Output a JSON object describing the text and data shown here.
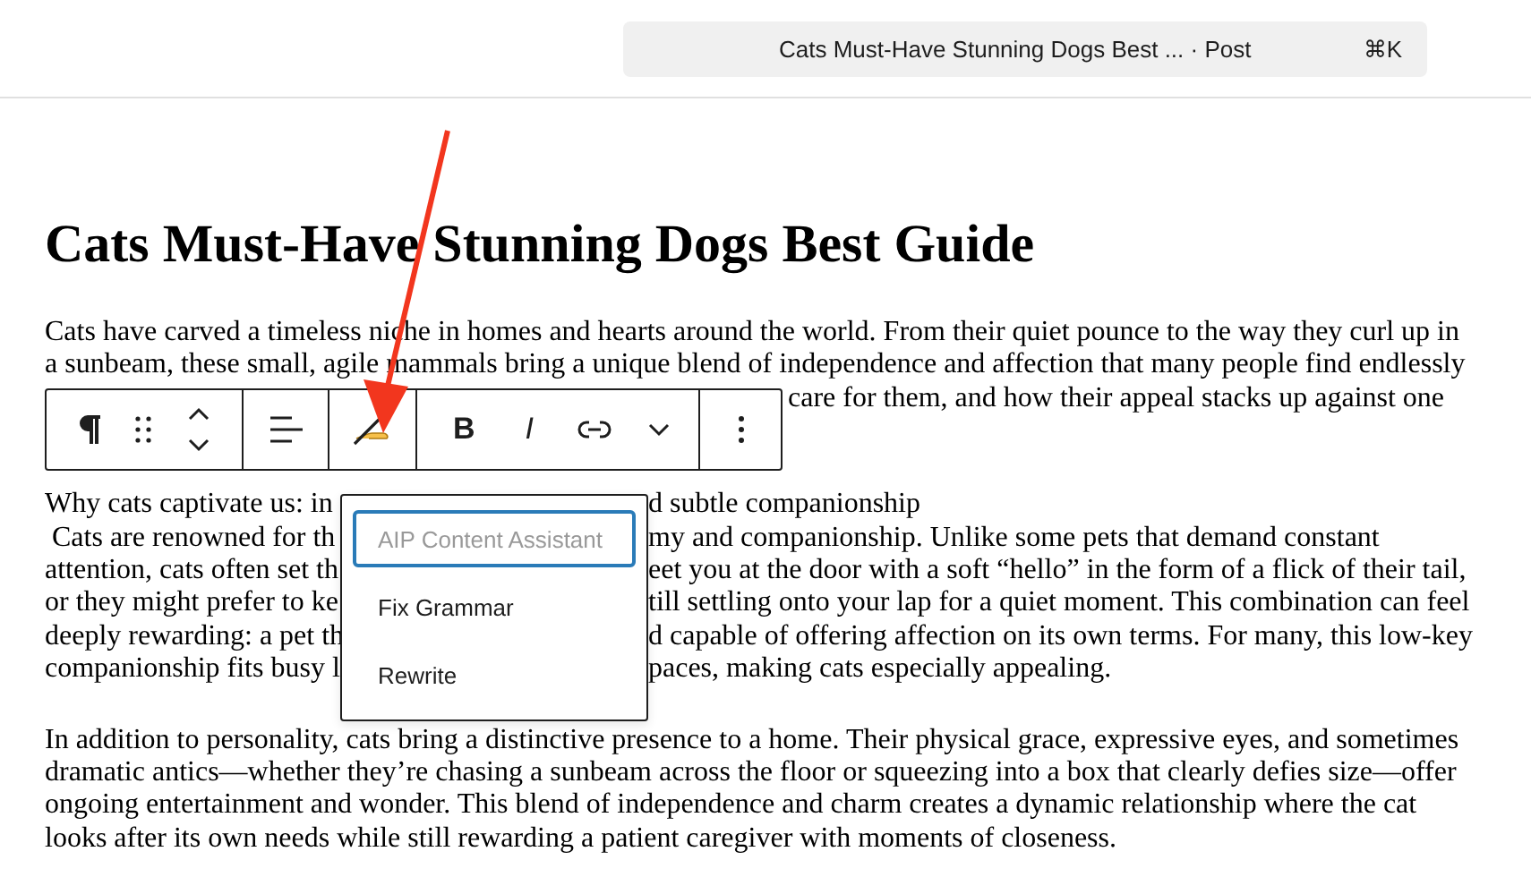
{
  "command_bar": {
    "title": "Cats Must-Have Stunning Dogs Best ... · Post",
    "shortcut": "⌘K"
  },
  "post_title": "Cats Must-Have Stunning Dogs Best Guide",
  "paragraphs": [
    {
      "lines": [
        {
          "left": "Cats have carved a timeless niche in homes and hearts around the world. From their quiet pounce to the way they curl up in"
        },
        {
          "left": "a sunbeam, these small, agile mammals bring a unique blend of independence and affection that many people find endlessly"
        },
        {
          "right": "care for them, and how their appeal stacks up against one"
        }
      ]
    },
    {
      "lines": [
        {
          "left": "Why cats captivate us: in",
          "right": "d subtle companionship"
        },
        {
          "left": " Cats are renowned for th",
          "right": "my and companionship. Unlike some pets that demand constant"
        },
        {
          "left": "attention, cats often set th",
          "right": "eet you at the door with a soft “hello” in the form of a flick of their tail,"
        },
        {
          "left": "or they might prefer to ke",
          "right": "till settling onto your lap for a quiet moment. This combination can feel"
        },
        {
          "left": "deeply rewarding: a pet th",
          "right": "d capable of offering affection on its own terms. For many, this low-key"
        },
        {
          "left": "companionship fits busy l",
          "right": "paces, making cats especially appealing."
        }
      ]
    },
    {
      "lines": [
        {
          "left": "In addition to personality, cats bring a distinctive presence to a home. Their physical grace, expressive eyes, and sometimes"
        },
        {
          "left": "dramatic antics—whether they’re chasing a sunbeam across the floor or squeezing into a box that clearly defies size—offer"
        },
        {
          "left": "ongoing entertainment and wonder. This blend of independence and charm creates a dynamic relationship where the cat"
        },
        {
          "left": "looks after its own needs while still rewarding a patient caregiver with moments of closeness."
        }
      ]
    }
  ],
  "toolbar": {
    "bold": "B",
    "italic": "I"
  },
  "menu": {
    "items": [
      {
        "label": "AIP Content Assistant",
        "disabled": true,
        "focused": true
      },
      {
        "label": "Fix Grammar",
        "disabled": false,
        "focused": false
      },
      {
        "label": "Rewrite",
        "disabled": false,
        "focused": false
      }
    ]
  }
}
